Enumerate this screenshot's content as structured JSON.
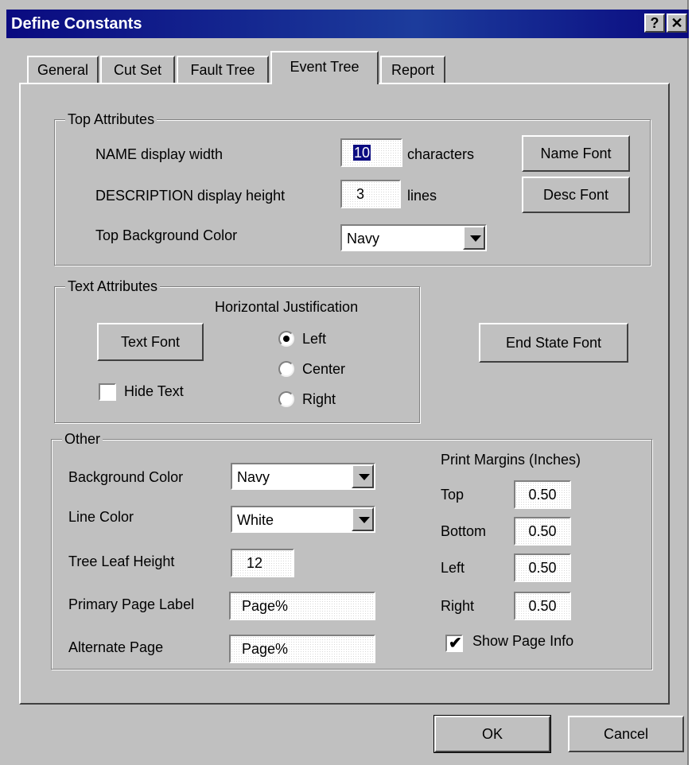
{
  "window": {
    "title": "Define Constants",
    "help_label": "?",
    "close_label": "✕"
  },
  "tabs": [
    {
      "label": "General",
      "active": false
    },
    {
      "label": "Cut Set",
      "active": false
    },
    {
      "label": "Fault Tree",
      "active": false
    },
    {
      "label": "Event Tree",
      "active": true
    },
    {
      "label": "Report",
      "active": false
    }
  ],
  "top_attributes": {
    "legend": "Top Attributes",
    "name_width_label": "NAME display width",
    "name_width_value": "10",
    "name_width_unit": "characters",
    "desc_height_label": "DESCRIPTION display height",
    "desc_height_value": "3",
    "desc_height_unit": "lines",
    "bg_color_label": "Top Background Color",
    "bg_color_value": "Navy",
    "name_font_button": "Name Font",
    "desc_font_button": "Desc Font"
  },
  "text_attributes": {
    "legend": "Text Attributes",
    "text_font_button": "Text Font",
    "hide_text_label": "Hide Text",
    "hide_text_checked": false,
    "justification_label": "Horizontal Justification",
    "options": [
      "Left",
      "Center",
      "Right"
    ],
    "selected": "Left"
  },
  "end_state_font_button": "End State Font",
  "other": {
    "legend": "Other",
    "bg_color_label": "Background Color",
    "bg_color_value": "Navy",
    "line_color_label": "Line Color",
    "line_color_value": "White",
    "leaf_height_label": "Tree Leaf Height",
    "leaf_height_value": "12",
    "primary_label": "Primary Page Label",
    "primary_value": "Page%",
    "alternate_label": "Alternate Page",
    "alternate_value": "Page%",
    "margins_title": "Print Margins (Inches)",
    "margins": [
      {
        "label": "Top",
        "value": "0.50"
      },
      {
        "label": "Bottom",
        "value": "0.50"
      },
      {
        "label": "Left",
        "value": "0.50"
      },
      {
        "label": "Right",
        "value": "0.50"
      }
    ],
    "show_page_info_label": "Show Page Info",
    "show_page_info_checked": true
  },
  "footer": {
    "ok_label": "OK",
    "cancel_label": "Cancel"
  },
  "colors": {
    "title_bar": "#0a0a80",
    "face": "#c0c0c0",
    "highlight": "#0a0a80"
  }
}
